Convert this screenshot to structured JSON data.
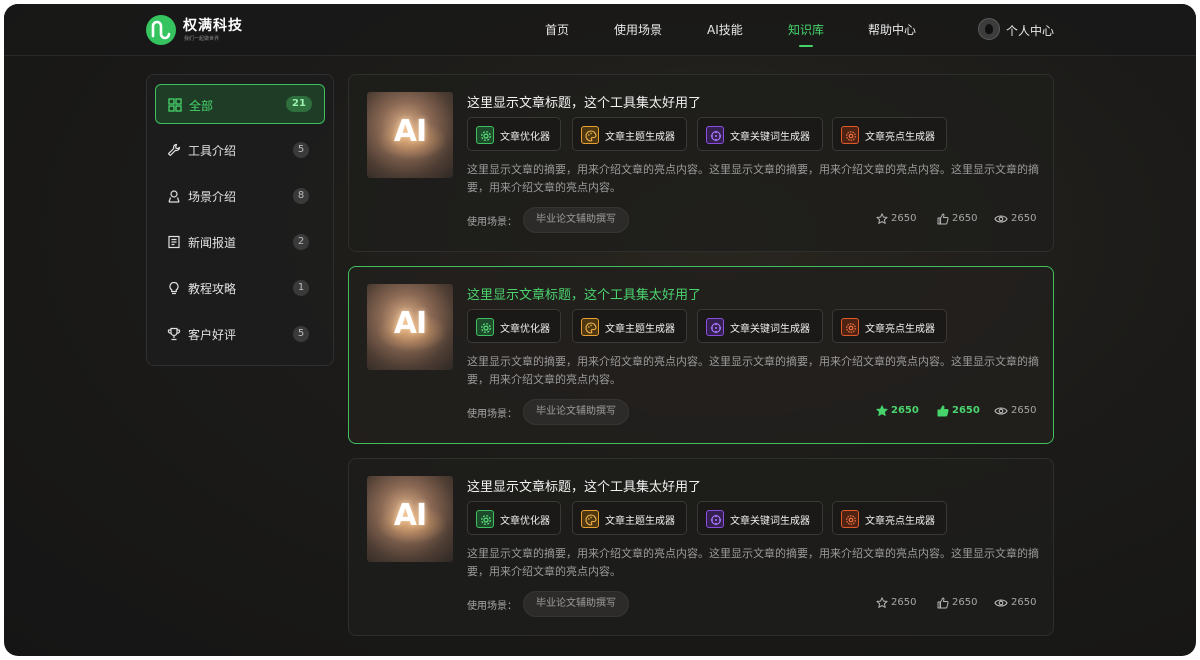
{
  "brand": {
    "name": "权满科技",
    "slogan": "我们一起做世界"
  },
  "nav": {
    "items": [
      {
        "label": "首页",
        "active": false
      },
      {
        "label": "使用场景",
        "active": false
      },
      {
        "label": "AI技能",
        "active": false
      },
      {
        "label": "知识库",
        "active": true
      },
      {
        "label": "帮助中心",
        "active": false
      }
    ],
    "user_label": "个人中心"
  },
  "sidebar": {
    "items": [
      {
        "label": "全部",
        "count": "21",
        "icon": "grid-icon",
        "active": true
      },
      {
        "label": "工具介绍",
        "count": "5",
        "icon": "wrench-icon",
        "active": false
      },
      {
        "label": "场景介绍",
        "count": "8",
        "icon": "scene-icon",
        "active": false
      },
      {
        "label": "新闻报道",
        "count": "2",
        "icon": "news-icon",
        "active": false
      },
      {
        "label": "教程攻略",
        "count": "1",
        "icon": "bulb-icon",
        "active": false
      },
      {
        "label": "客户好评",
        "count": "5",
        "icon": "trophy-icon",
        "active": false
      }
    ]
  },
  "colors": {
    "accent": "#45d36a",
    "tool_green": "#3fbf5e",
    "tool_orange": "#e8a030",
    "tool_purple": "#8a4de0",
    "tool_red": "#e05a2a"
  },
  "articles": [
    {
      "thumb_text": "AI",
      "title": "这里显示文章标题，这个工具集太好用了",
      "tools": [
        {
          "label": "文章优化器",
          "icon": "gear-icon"
        },
        {
          "label": "文章主题生成器",
          "icon": "palette-icon"
        },
        {
          "label": "文章关键词生成器",
          "icon": "target-icon"
        },
        {
          "label": "文章亮点生成器",
          "icon": "sparkle-icon"
        }
      ],
      "summary": "这里显示文章的摘要，用来介绍文章的亮点内容。这里显示文章的摘要，用来介绍文章的亮点内容。这里显示文章的摘要，用来介绍文章的亮点内容。",
      "scene_label": "使用场景：",
      "scene_tag": "毕业论文辅助撰写",
      "favorites": "2650",
      "likes": "2650",
      "views": "2650",
      "active": false
    },
    {
      "thumb_text": "AI",
      "title": "这里显示文章标题，这个工具集太好用了",
      "tools": [
        {
          "label": "文章优化器",
          "icon": "gear-icon"
        },
        {
          "label": "文章主题生成器",
          "icon": "palette-icon"
        },
        {
          "label": "文章关键词生成器",
          "icon": "target-icon"
        },
        {
          "label": "文章亮点生成器",
          "icon": "sparkle-icon"
        }
      ],
      "summary": "这里显示文章的摘要，用来介绍文章的亮点内容。这里显示文章的摘要，用来介绍文章的亮点内容。这里显示文章的摘要，用来介绍文章的亮点内容。",
      "scene_label": "使用场景：",
      "scene_tag": "毕业论文辅助撰写",
      "favorites": "2650",
      "likes": "2650",
      "views": "2650",
      "active": true
    },
    {
      "thumb_text": "AI",
      "title": "这里显示文章标题，这个工具集太好用了",
      "tools": [
        {
          "label": "文章优化器",
          "icon": "gear-icon"
        },
        {
          "label": "文章主题生成器",
          "icon": "palette-icon"
        },
        {
          "label": "文章关键词生成器",
          "icon": "target-icon"
        },
        {
          "label": "文章亮点生成器",
          "icon": "sparkle-icon"
        }
      ],
      "summary": "这里显示文章的摘要，用来介绍文章的亮点内容。这里显示文章的摘要，用来介绍文章的亮点内容。这里显示文章的摘要，用来介绍文章的亮点内容。",
      "scene_label": "使用场景：",
      "scene_tag": "毕业论文辅助撰写",
      "favorites": "2650",
      "likes": "2650",
      "views": "2650",
      "active": false
    }
  ]
}
